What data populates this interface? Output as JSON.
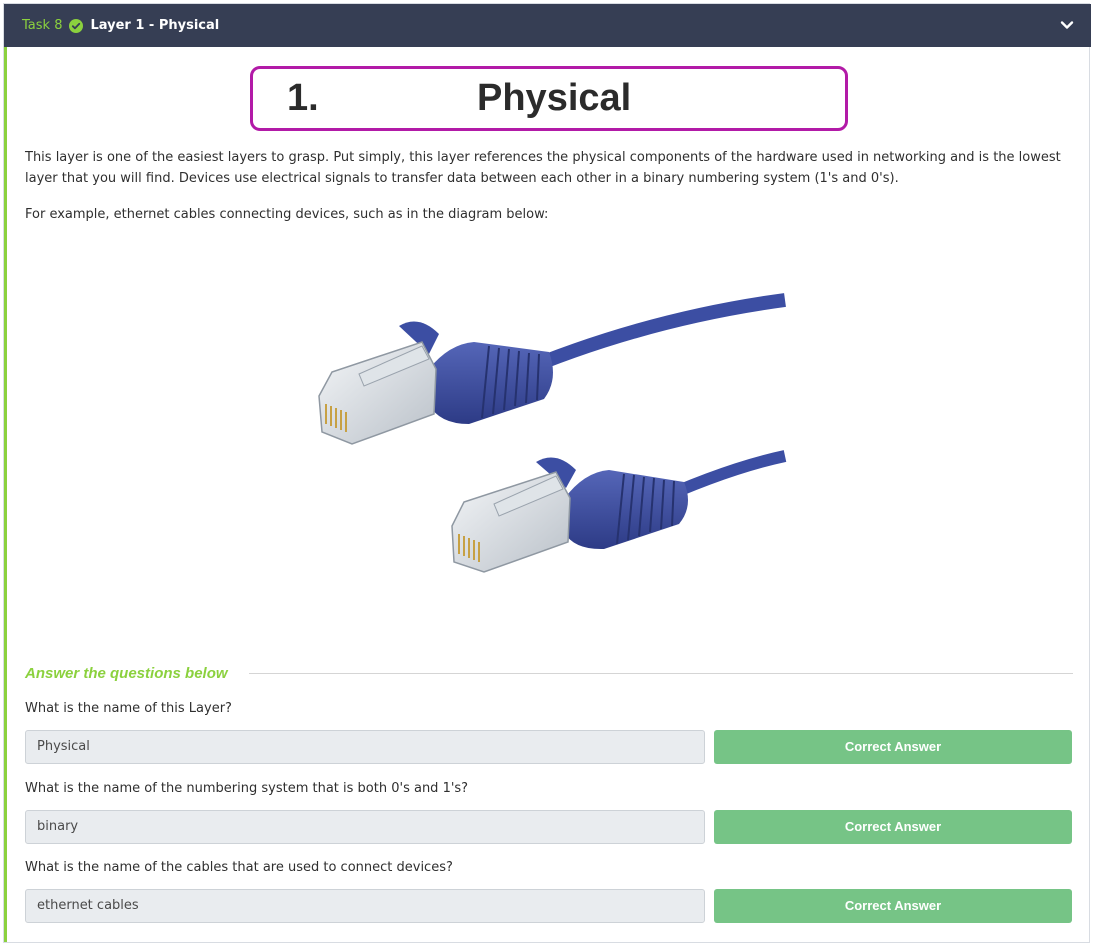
{
  "task": {
    "number": "Task 8",
    "title": "Layer 1 - Physical",
    "icons": {
      "status": "check-circle-icon",
      "toggle": "chevron-down-icon"
    }
  },
  "banner": {
    "number": "1.",
    "word": "Physical"
  },
  "content": {
    "paragraph1_line1": "This layer is one of the easiest layers to grasp. Put simply, this layer references the physical components of the hardware used in networking and is the lowest",
    "paragraph1_line2": "layer that you will find. Devices use electrical signals to transfer data between each other in a binary numbering system (1's and 0's).",
    "paragraph2": "For example, ethernet cables connecting devices, such as in the diagram below:"
  },
  "questions_section": {
    "heading": "Answer the questions below"
  },
  "questions": [
    {
      "question": "What is the name of this Layer?",
      "answer": "Physical",
      "button": "Correct Answer"
    },
    {
      "question": "What is the name of the numbering system that is both 0's and 1's?",
      "answer": "binary",
      "button": "Correct Answer"
    },
    {
      "question": "What is the name of the cables that are used to connect devices?",
      "answer": "ethernet cables",
      "button": "Correct Answer"
    }
  ],
  "colors": {
    "header_bg": "#363e54",
    "accent_green": "#8bd13e",
    "banner_border": "#b21aa7",
    "button_green": "#76c486",
    "cable_blue": "#3c4ea3"
  }
}
